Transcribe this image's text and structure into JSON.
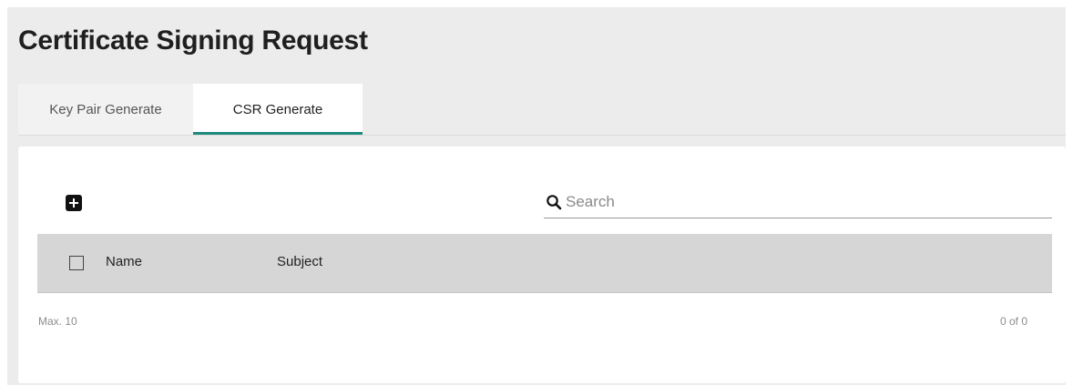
{
  "page": {
    "title": "Certificate Signing Request"
  },
  "tabs": [
    {
      "label": "Key Pair Generate",
      "active": false
    },
    {
      "label": "CSR Generate",
      "active": true
    }
  ],
  "toolbar": {
    "add_icon": "plus-square-icon",
    "search_icon": "magnifier-icon",
    "search_placeholder": "Search",
    "search_value": ""
  },
  "table": {
    "columns": [
      "Name",
      "Subject"
    ],
    "rows": []
  },
  "footer": {
    "max_label": "Max. 10",
    "count_label": "0 of 0"
  },
  "colors": {
    "accent": "#1e8a7e",
    "header_bg": "#d6d6d6",
    "page_bg": "#ececec"
  }
}
